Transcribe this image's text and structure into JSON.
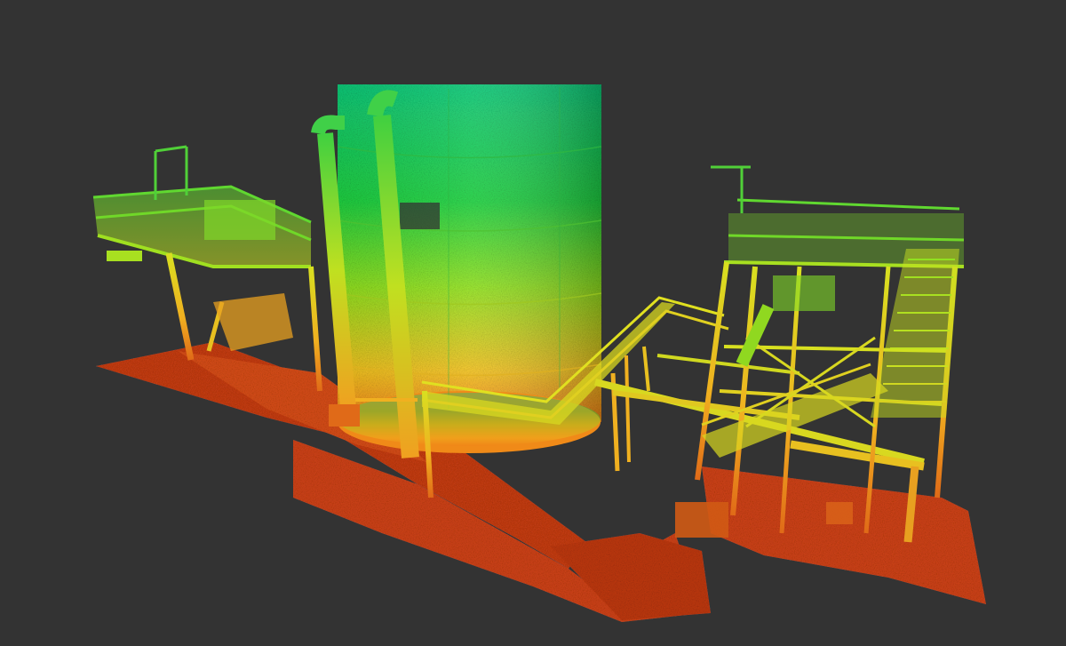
{
  "viewer": {
    "background_color": "#333333"
  },
  "point_cloud": {
    "subject": "industrial-tank-and-platform-structure",
    "colormap": "height-elevation",
    "colormap_stops": [
      "#c83a10",
      "#e06a18",
      "#f0b020",
      "#d8e020",
      "#80e020",
      "#20c850",
      "#10c878"
    ],
    "visible_objects": [
      "ground-slab",
      "storage-tank",
      "vertical-pipes",
      "left-platform",
      "right-platform",
      "staircase",
      "pipe-rack",
      "walkway-bridge",
      "support-columns"
    ]
  }
}
